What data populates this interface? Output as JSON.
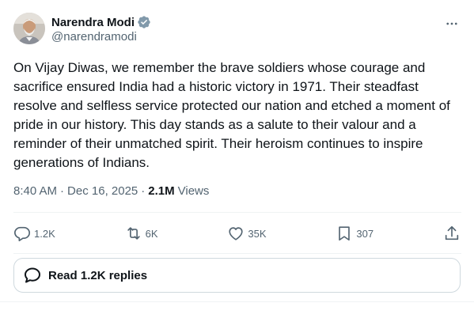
{
  "author": {
    "display_name": "Narendra Modi",
    "handle": "@narendramodi",
    "verified": true,
    "verified_color": "#829aab"
  },
  "tweet": {
    "text": "On Vijay Diwas, we remember the brave soldiers whose courage and sacrifice ensured India had a historic victory in 1971. Their steadfast resolve and selfless service protected our nation and etched a moment of pride in our history. This day stands as a salute to their valour and a reminder of their unmatched spirit. Their heroism continues to inspire generations of Indians.",
    "time": "8:40 AM",
    "separator": "·",
    "date": "Dec 16, 2025",
    "views_count": "2.1M",
    "views_label": "Views"
  },
  "actions": {
    "replies": {
      "icon": "reply-icon",
      "count": "1.2K"
    },
    "reposts": {
      "icon": "repost-icon",
      "count": "6K"
    },
    "likes": {
      "icon": "heart-icon",
      "count": "35K"
    },
    "bookmarks": {
      "icon": "bookmark-icon",
      "count": "307"
    },
    "share": {
      "icon": "share-icon"
    }
  },
  "read_replies": {
    "icon": "speech-bubble-icon",
    "label": "Read 1.2K replies"
  },
  "colors": {
    "text_primary": "#0f1419",
    "text_secondary": "#536471",
    "border": "#cfd9de",
    "divider": "#eff3f4"
  }
}
